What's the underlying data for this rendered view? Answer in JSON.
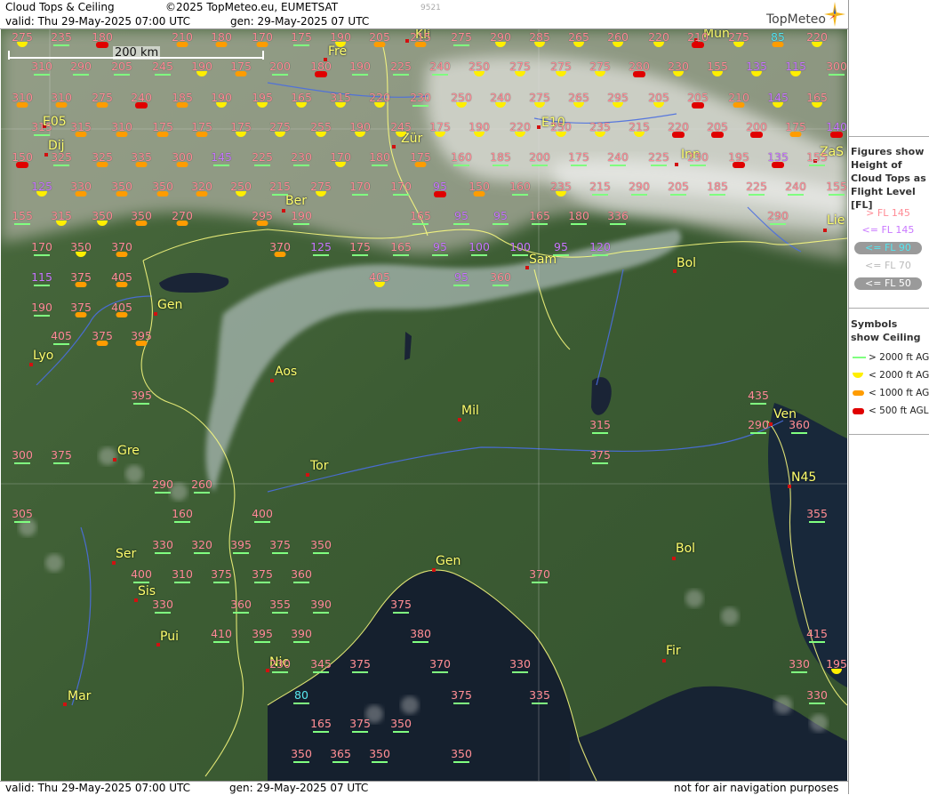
{
  "header": {
    "title": "Cloud Tops & Ceiling",
    "copyright": "©2025 TopMeteo.eu, EUMETSAT",
    "valid": "valid:  Thu  29-May-2025  07:00 UTC",
    "gen": "gen: 29-May-2025 07 UTC",
    "image_id": "9521",
    "logo": "TopMeteo"
  },
  "footer": {
    "valid": "valid:  Thu  29-May-2025  07:00  UTC",
    "gen": "gen: 29-May-2025 07 UTC",
    "disclaimer": "not for air navigation purposes"
  },
  "scale": {
    "label": "200 km"
  },
  "legend": {
    "figures_title": "Figures show Height of Cloud Tops as Flight Level  [FL]",
    "fl_entries": [
      "> FL 145",
      "<= FL 145",
      "<= FL 90",
      "<= FL 70",
      "<= FL 50"
    ],
    "symbols_title": "Symbols show Ceiling",
    "symbol_entries": [
      "> 2000 ft AGL",
      "< 2000 ft AGL",
      "< 1000 ft AGL",
      "< 500 ft AGL"
    ]
  },
  "colors": {
    "fl_high": "#ff8c96",
    "fl_mid": "#c978ff",
    "fl_low": "#54e6f0",
    "ceil_green": "#80ff80",
    "ceil_yellow": "#ffef00",
    "ceil_orange": "#ff9c00",
    "ceil_red": "#e00000",
    "city_label": "#ffff6e",
    "border_line": "#ffff80",
    "river_line": "#4a6ee0"
  },
  "cities": [
    "Mun",
    "Kli",
    "Fre",
    "Zür",
    "E05",
    "E10",
    "Dij",
    "Inn",
    "ZaS",
    "Ber",
    "Lie",
    "Sam",
    "Bol",
    "Gen",
    "Lyo",
    "Aos",
    "Mil",
    "Ven",
    "Gre",
    "Tor",
    "N45",
    "Ser",
    "Gen",
    "Bol",
    "Sis",
    "Pui",
    "Nic",
    "Fir",
    "Mar"
  ],
  "stations": [
    [
      "275",
      "y"
    ],
    [
      "235",
      "g"
    ],
    [
      "180",
      "r"
    ],
    [
      "210",
      "o"
    ],
    [
      "180",
      "o"
    ],
    [
      "170",
      "o"
    ],
    [
      "175",
      "g"
    ],
    [
      "190",
      "y"
    ],
    [
      "205",
      "o"
    ],
    [
      "215",
      "o"
    ],
    [
      "275",
      "g"
    ],
    [
      "290",
      "y"
    ],
    [
      "285",
      "y"
    ],
    [
      "265",
      "y"
    ],
    [
      "260",
      "y"
    ],
    [
      "220",
      "y"
    ],
    [
      "210",
      "r"
    ],
    [
      "275",
      "y"
    ],
    [
      "85",
      "o"
    ],
    [
      "220",
      "y"
    ],
    [
      "310",
      "g"
    ],
    [
      "290",
      "g"
    ],
    [
      "205",
      "g"
    ],
    [
      "245",
      "g"
    ],
    [
      "190",
      "y"
    ],
    [
      "175",
      "o"
    ],
    [
      "200",
      "g"
    ],
    [
      "180",
      "r"
    ],
    [
      "190",
      "g"
    ],
    [
      "225",
      "g"
    ],
    [
      "240",
      "g"
    ],
    [
      "250",
      "y"
    ],
    [
      "275",
      "y"
    ],
    [
      "275",
      "y"
    ],
    [
      "275",
      "y"
    ],
    [
      "280",
      "r"
    ],
    [
      "230",
      "y"
    ],
    [
      "155",
      "y"
    ],
    [
      "135",
      "y"
    ],
    [
      "115",
      "y"
    ],
    [
      "300",
      "g"
    ],
    [
      "310",
      "o"
    ],
    [
      "310",
      "o"
    ],
    [
      "275",
      "o"
    ],
    [
      "240",
      "r"
    ],
    [
      "185",
      "o"
    ],
    [
      "190",
      "y"
    ],
    [
      "195",
      "y"
    ],
    [
      "165",
      "y"
    ],
    [
      "315",
      "y"
    ],
    [
      "220",
      "y"
    ],
    [
      "230",
      "g"
    ],
    [
      "250",
      "y"
    ],
    [
      "240",
      "y"
    ],
    [
      "275",
      "y"
    ],
    [
      "265",
      "y"
    ],
    [
      "295",
      "y"
    ],
    [
      "205",
      "y"
    ],
    [
      "205",
      "r"
    ],
    [
      "210",
      "o"
    ],
    [
      "145",
      "y"
    ],
    [
      "165",
      "y"
    ],
    [
      "315",
      "g"
    ],
    [
      "315",
      "o"
    ],
    [
      "310",
      "o"
    ],
    [
      "175",
      "o"
    ],
    [
      "175",
      "o"
    ],
    [
      "175",
      "y"
    ],
    [
      "275",
      "y"
    ],
    [
      "255",
      "y"
    ],
    [
      "190",
      "y"
    ],
    [
      "245",
      "y"
    ],
    [
      "175",
      "y"
    ],
    [
      "190",
      "y"
    ],
    [
      "220",
      "y"
    ],
    [
      "250",
      "y"
    ],
    [
      "235",
      "y"
    ],
    [
      "215",
      "y"
    ],
    [
      "220",
      "r"
    ],
    [
      "205",
      "r"
    ],
    [
      "200",
      "r"
    ],
    [
      "175",
      "o"
    ],
    [
      "140",
      "r"
    ],
    [
      "150",
      "r"
    ],
    [
      "325",
      "g"
    ],
    [
      "325",
      "o"
    ],
    [
      "335",
      "o"
    ],
    [
      "300",
      "o"
    ],
    [
      "145",
      "g"
    ],
    [
      "225",
      "g"
    ],
    [
      "230",
      "g"
    ],
    [
      "170",
      "y"
    ],
    [
      "180",
      "g"
    ],
    [
      "175",
      "o"
    ],
    [
      "160",
      "g"
    ],
    [
      "185",
      "g"
    ],
    [
      "200",
      "g"
    ],
    [
      "175",
      "g"
    ],
    [
      "240",
      "g"
    ],
    [
      "225",
      "g"
    ],
    [
      "230",
      "g"
    ],
    [
      "195",
      "r"
    ],
    [
      "135",
      "r"
    ],
    [
      "155",
      "g"
    ],
    [
      "125",
      "y"
    ],
    [
      "330",
      "o"
    ],
    [
      "350",
      "o"
    ],
    [
      "350",
      "o"
    ],
    [
      "320",
      "o"
    ],
    [
      "250",
      "y"
    ],
    [
      "215",
      "g"
    ],
    [
      "275",
      "y"
    ],
    [
      "170",
      "g"
    ],
    [
      "170",
      "g"
    ],
    [
      "95",
      "r"
    ],
    [
      "150",
      "o"
    ],
    [
      "160",
      "g"
    ],
    [
      "235",
      "y"
    ],
    [
      "215",
      "g"
    ],
    [
      "290",
      "g"
    ],
    [
      "205",
      "g"
    ],
    [
      "185",
      "g"
    ],
    [
      "225",
      "g"
    ],
    [
      "240",
      "g"
    ],
    [
      "155",
      "g"
    ],
    [
      "155",
      "g"
    ],
    [
      "315",
      "y"
    ],
    [
      "350",
      "y"
    ],
    [
      "350",
      "o"
    ],
    [
      "270",
      "o"
    ],
    [
      "295",
      "o"
    ],
    [
      "190",
      "g"
    ],
    [
      "165",
      "g"
    ],
    [
      "95",
      "g"
    ],
    [
      "95",
      "g"
    ],
    [
      "165",
      "g"
    ],
    [
      "180",
      "g"
    ],
    [
      "336",
      "g"
    ],
    [
      "290",
      "g"
    ],
    [
      "170",
      "g"
    ],
    [
      "350",
      "y"
    ],
    [
      "370",
      "o"
    ],
    [
      "370",
      "o"
    ],
    [
      "125",
      "g"
    ],
    [
      "175",
      "g"
    ],
    [
      "165",
      "g"
    ],
    [
      "95",
      "g"
    ],
    [
      "100",
      "g"
    ],
    [
      "100",
      "g"
    ],
    [
      "95",
      "g"
    ],
    [
      "120",
      "g"
    ],
    [
      "115",
      "g"
    ],
    [
      "375",
      "o"
    ],
    [
      "405",
      "o"
    ],
    [
      "405",
      "y"
    ],
    [
      "95",
      "g"
    ],
    [
      "360",
      "g"
    ],
    [
      "190",
      "g"
    ],
    [
      "375",
      "o"
    ],
    [
      "405",
      "o"
    ],
    [
      "405",
      "g"
    ],
    [
      "375",
      "o"
    ],
    [
      "395",
      "o"
    ],
    [
      "395",
      "g"
    ],
    [
      "435",
      "g"
    ],
    [
      "315",
      "g"
    ],
    [
      "290",
      "g"
    ],
    [
      "360",
      "g"
    ],
    [
      "300",
      "g"
    ],
    [
      "375",
      "g"
    ],
    [
      "375",
      "g"
    ],
    [
      "290",
      "g"
    ],
    [
      "260",
      "g"
    ],
    [
      "305",
      "g"
    ],
    [
      "160",
      "g"
    ],
    [
      "400",
      "g"
    ],
    [
      "355",
      "g"
    ],
    [
      "330",
      "g"
    ],
    [
      "320",
      "g"
    ],
    [
      "395",
      "g"
    ],
    [
      "375",
      "g"
    ],
    [
      "350",
      "g"
    ],
    [
      "400",
      "g"
    ],
    [
      "310",
      "g"
    ],
    [
      "375",
      "g"
    ],
    [
      "375",
      "g"
    ],
    [
      "360",
      "g"
    ],
    [
      "370",
      "g"
    ],
    [
      "330",
      "g"
    ],
    [
      "360",
      "g"
    ],
    [
      "355",
      "g"
    ],
    [
      "390",
      "g"
    ],
    [
      "375",
      "g"
    ],
    [
      "410",
      "g"
    ],
    [
      "395",
      "g"
    ],
    [
      "390",
      "g"
    ],
    [
      "380",
      "g"
    ],
    [
      "415",
      "g"
    ],
    [
      "230",
      "g"
    ],
    [
      "345",
      "g"
    ],
    [
      "375",
      "g"
    ],
    [
      "370",
      "g"
    ],
    [
      "330",
      "g"
    ],
    [
      "330",
      "g"
    ],
    [
      "195",
      "y"
    ],
    [
      "80",
      "g"
    ],
    [
      "375",
      "g"
    ],
    [
      "335",
      "g"
    ],
    [
      "330",
      "g"
    ],
    [
      "165",
      "g"
    ],
    [
      "375",
      "g"
    ],
    [
      "350",
      "g"
    ],
    [
      "350",
      "g"
    ],
    [
      "365",
      "g"
    ],
    [
      "350",
      "g"
    ],
    [
      "350",
      "g"
    ],
    [
      "350",
      "g"
    ]
  ]
}
